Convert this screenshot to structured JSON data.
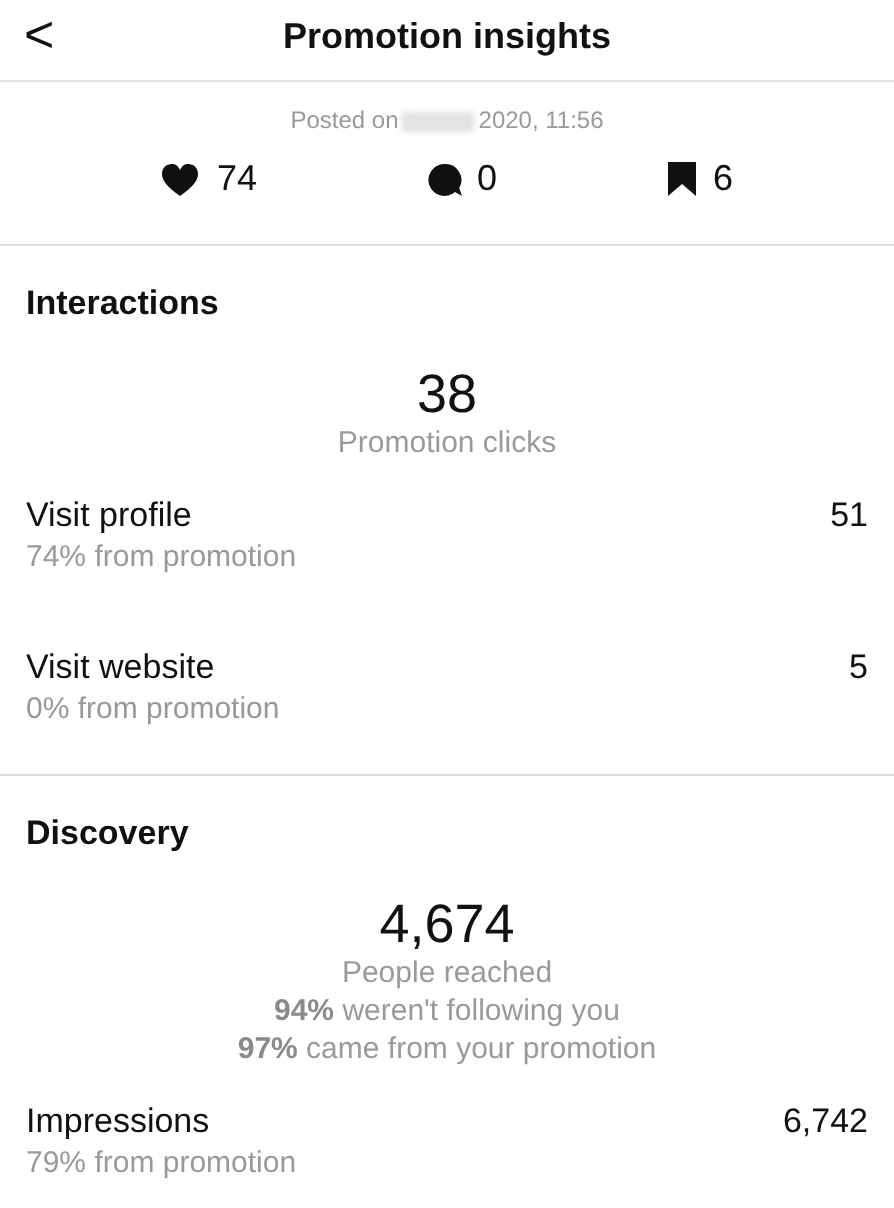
{
  "header": {
    "back": "<",
    "title": "Promotion insights"
  },
  "posted": {
    "prefix": "Posted on",
    "date": "2020, 11:56"
  },
  "stats": [
    {
      "kind": "likes",
      "value": "74"
    },
    {
      "kind": "comments",
      "value": "0"
    },
    {
      "kind": "saves",
      "value": "6"
    }
  ],
  "sections": [
    {
      "title": "Interactions",
      "big_number": "38",
      "big_label": "Promotion clicks",
      "rows": [
        {
          "label": "Visit profile",
          "sub": "74% from promotion",
          "value": "51"
        },
        {
          "label": "Visit website",
          "sub": "0% from promotion",
          "value": "5"
        }
      ]
    },
    {
      "title": "Discovery",
      "big_number": "4,674",
      "big_label": "People reached",
      "notes": [
        "**94%** weren't following you",
        "**97%** came from your promotion"
      ],
      "rows": [
        {
          "label": "Impressions",
          "sub": "79% from promotion",
          "value": "6,742"
        }
      ]
    }
  ]
}
